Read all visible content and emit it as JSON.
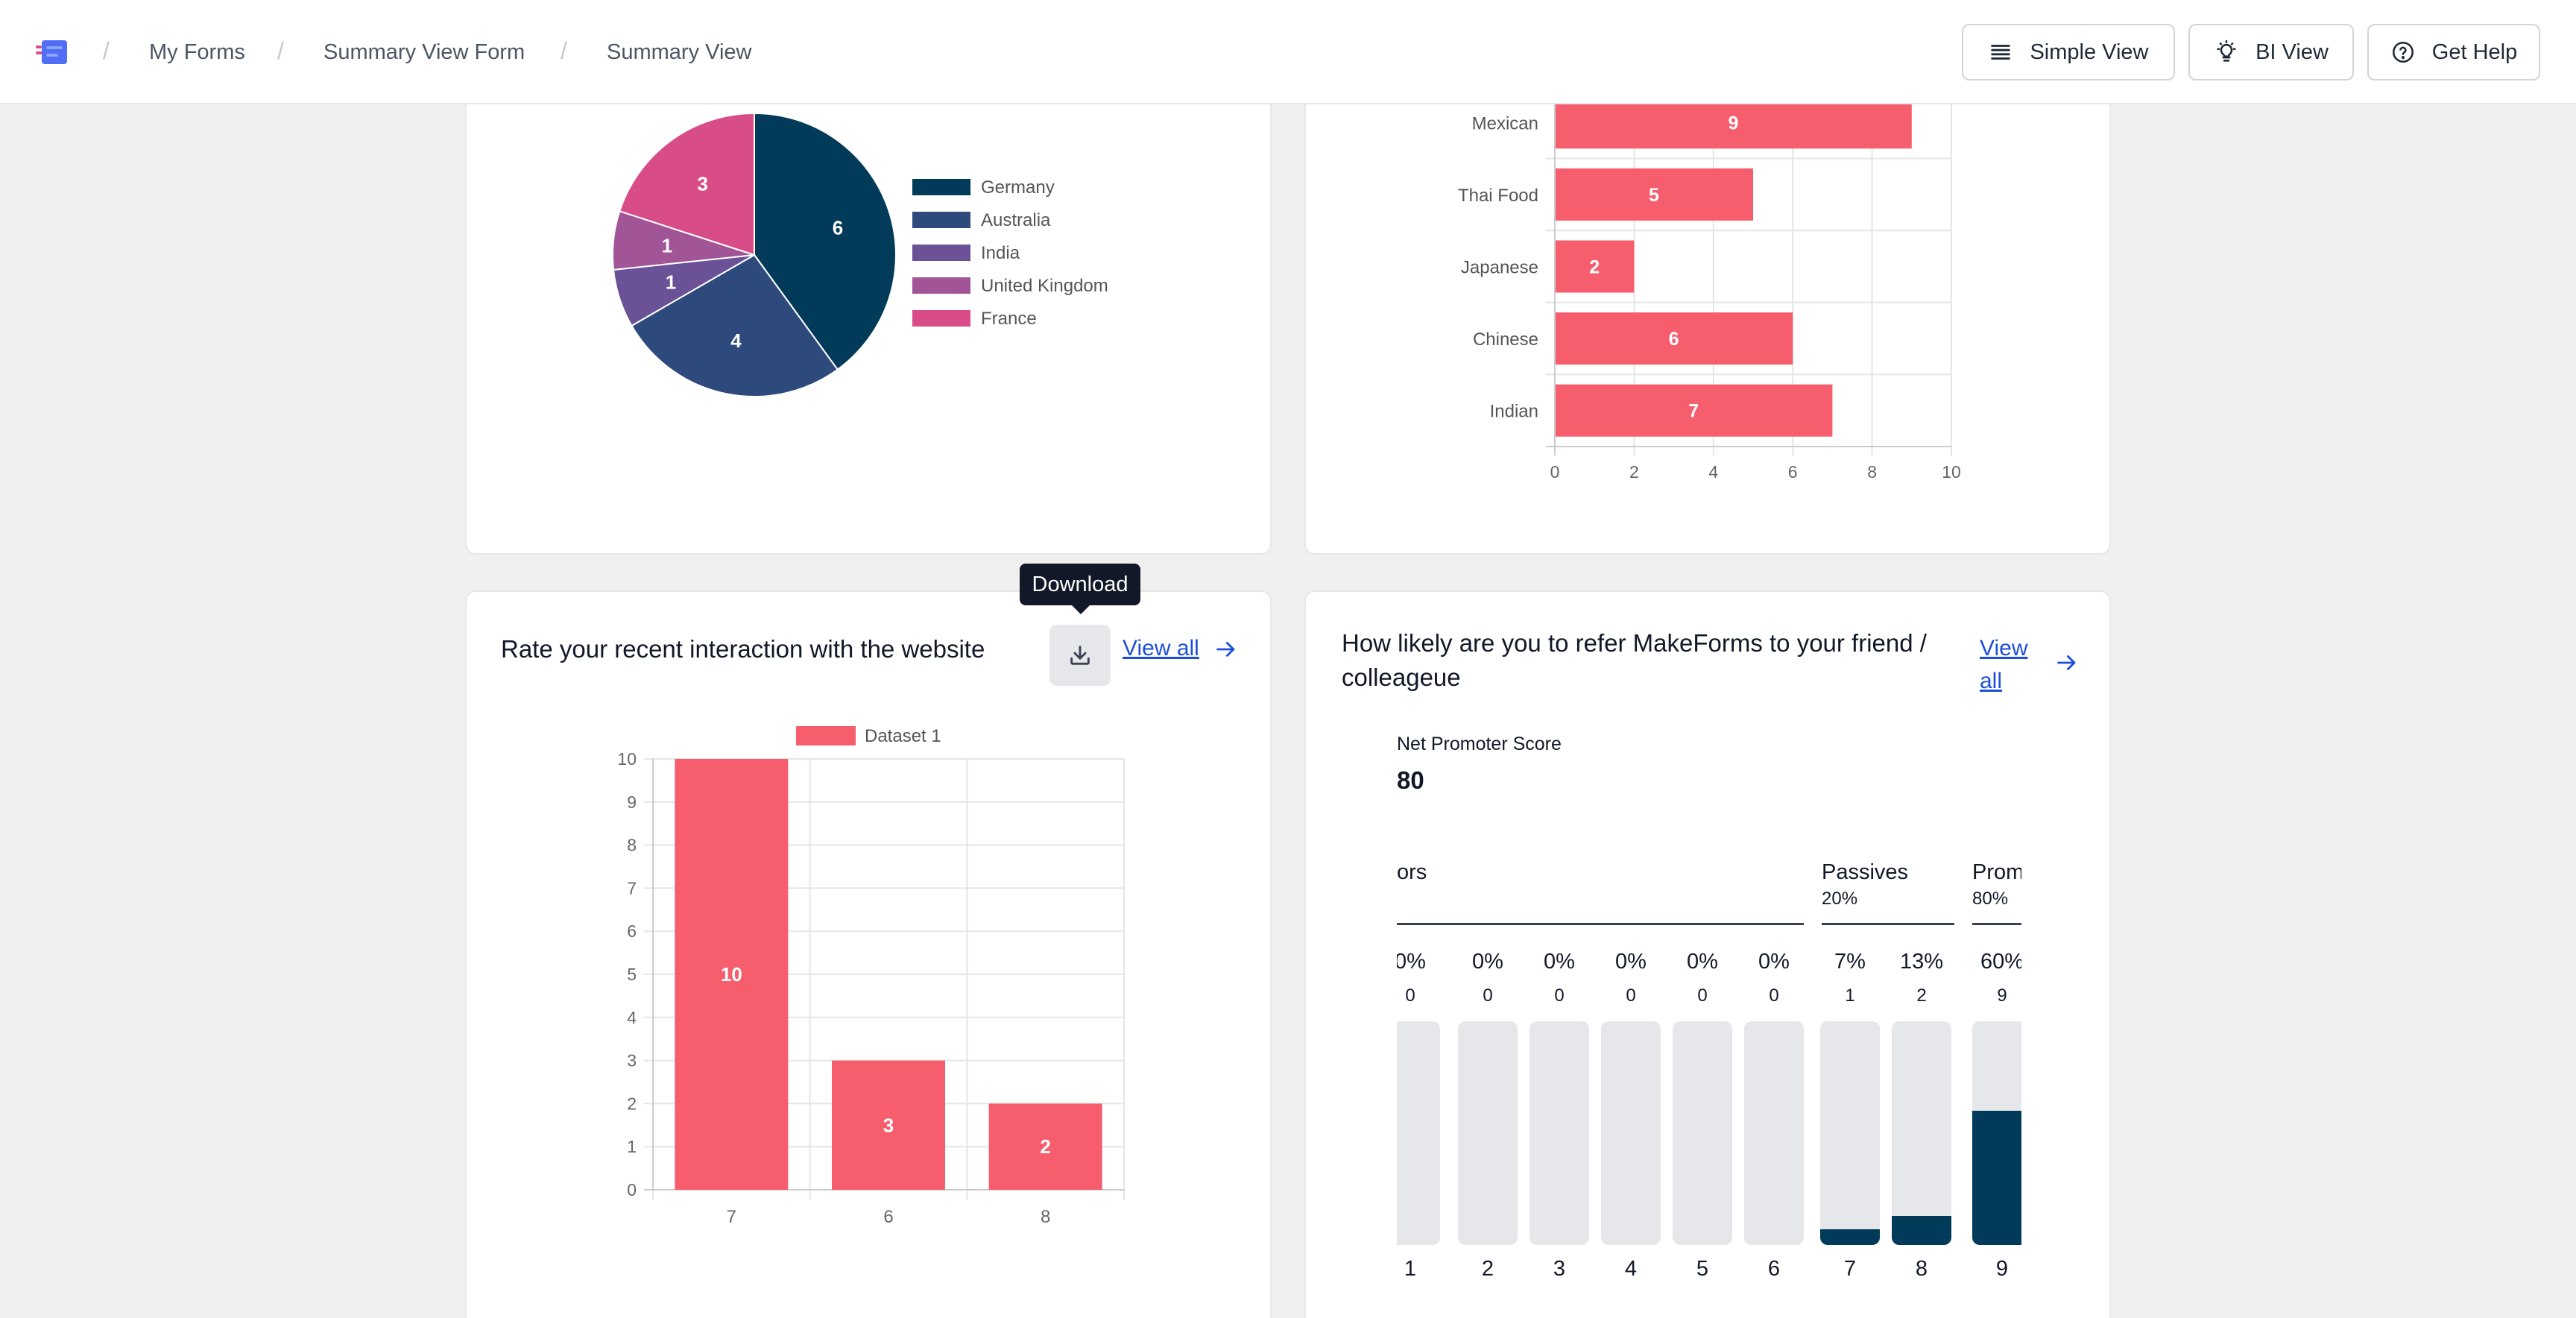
{
  "header": {
    "breadcrumbs": [
      "My Forms",
      "Summary View Form",
      "Summary View"
    ],
    "buttons": {
      "simple_view": "Simple View",
      "bi_view": "BI View",
      "get_help": "Get Help"
    }
  },
  "colors": {
    "primary_bar": "#f65e6e",
    "navy": "#023b5a",
    "link": "#1d4ed8"
  },
  "pie_card": {
    "chart_data": {
      "type": "pie",
      "labels": [
        "Germany",
        "Australia",
        "India",
        "United Kingdom",
        "France"
      ],
      "values": [
        6,
        4,
        1,
        1,
        3
      ],
      "colors": [
        "#023b5a",
        "#2e4a7d",
        "#6b5196",
        "#a15496",
        "#d84d88"
      ],
      "legend_position": "right"
    }
  },
  "cuisine_card": {
    "chart_data": {
      "type": "bar",
      "orientation": "horizontal",
      "categories": [
        "Mexican",
        "Thai Food",
        "Japanese",
        "Chinese",
        "Indian"
      ],
      "values": [
        9,
        5,
        2,
        6,
        7
      ],
      "partial_top_value": 5,
      "xlim": [
        0,
        10
      ],
      "xticks": [
        0,
        2,
        4,
        6,
        8,
        10
      ],
      "grid": true
    }
  },
  "rating_card": {
    "title": "Rate your recent interaction with the website",
    "view_all": "View all",
    "tooltip": "Download",
    "chart_data": {
      "type": "bar",
      "categories": [
        "7",
        "6",
        "8"
      ],
      "series": [
        {
          "name": "Dataset 1",
          "values": [
            10,
            3,
            2
          ]
        }
      ],
      "ylim": [
        0,
        10
      ],
      "yticks": [
        0,
        1,
        2,
        3,
        4,
        5,
        6,
        7,
        8,
        9,
        10
      ],
      "legend": "top",
      "grid": true
    }
  },
  "nps_card": {
    "title": "How likely are you to refer MakeForms to your friend / colleageue",
    "view_all": "View all",
    "score_label": "Net Promoter Score",
    "score": "80",
    "groups": [
      {
        "name": "Detractors",
        "pct": "",
        "visible_name": "ors"
      },
      {
        "name": "Passives",
        "pct": "20%"
      },
      {
        "name": "Promoters",
        "pct": "80%",
        "visible_name": "Prom"
      }
    ],
    "columns": [
      {
        "score": "1",
        "pct": "0%",
        "count": "0",
        "fill": 0
      },
      {
        "score": "2",
        "pct": "0%",
        "count": "0",
        "fill": 0
      },
      {
        "score": "3",
        "pct": "0%",
        "count": "0",
        "fill": 0
      },
      {
        "score": "4",
        "pct": "0%",
        "count": "0",
        "fill": 0
      },
      {
        "score": "5",
        "pct": "0%",
        "count": "0",
        "fill": 0
      },
      {
        "score": "6",
        "pct": "0%",
        "count": "0",
        "fill": 0
      },
      {
        "score": "7",
        "pct": "7%",
        "count": "1",
        "fill": 0.07
      },
      {
        "score": "8",
        "pct": "13%",
        "count": "2",
        "fill": 0.13
      },
      {
        "score": "9",
        "pct": "60%",
        "count": "9",
        "fill": 0.6
      }
    ]
  }
}
